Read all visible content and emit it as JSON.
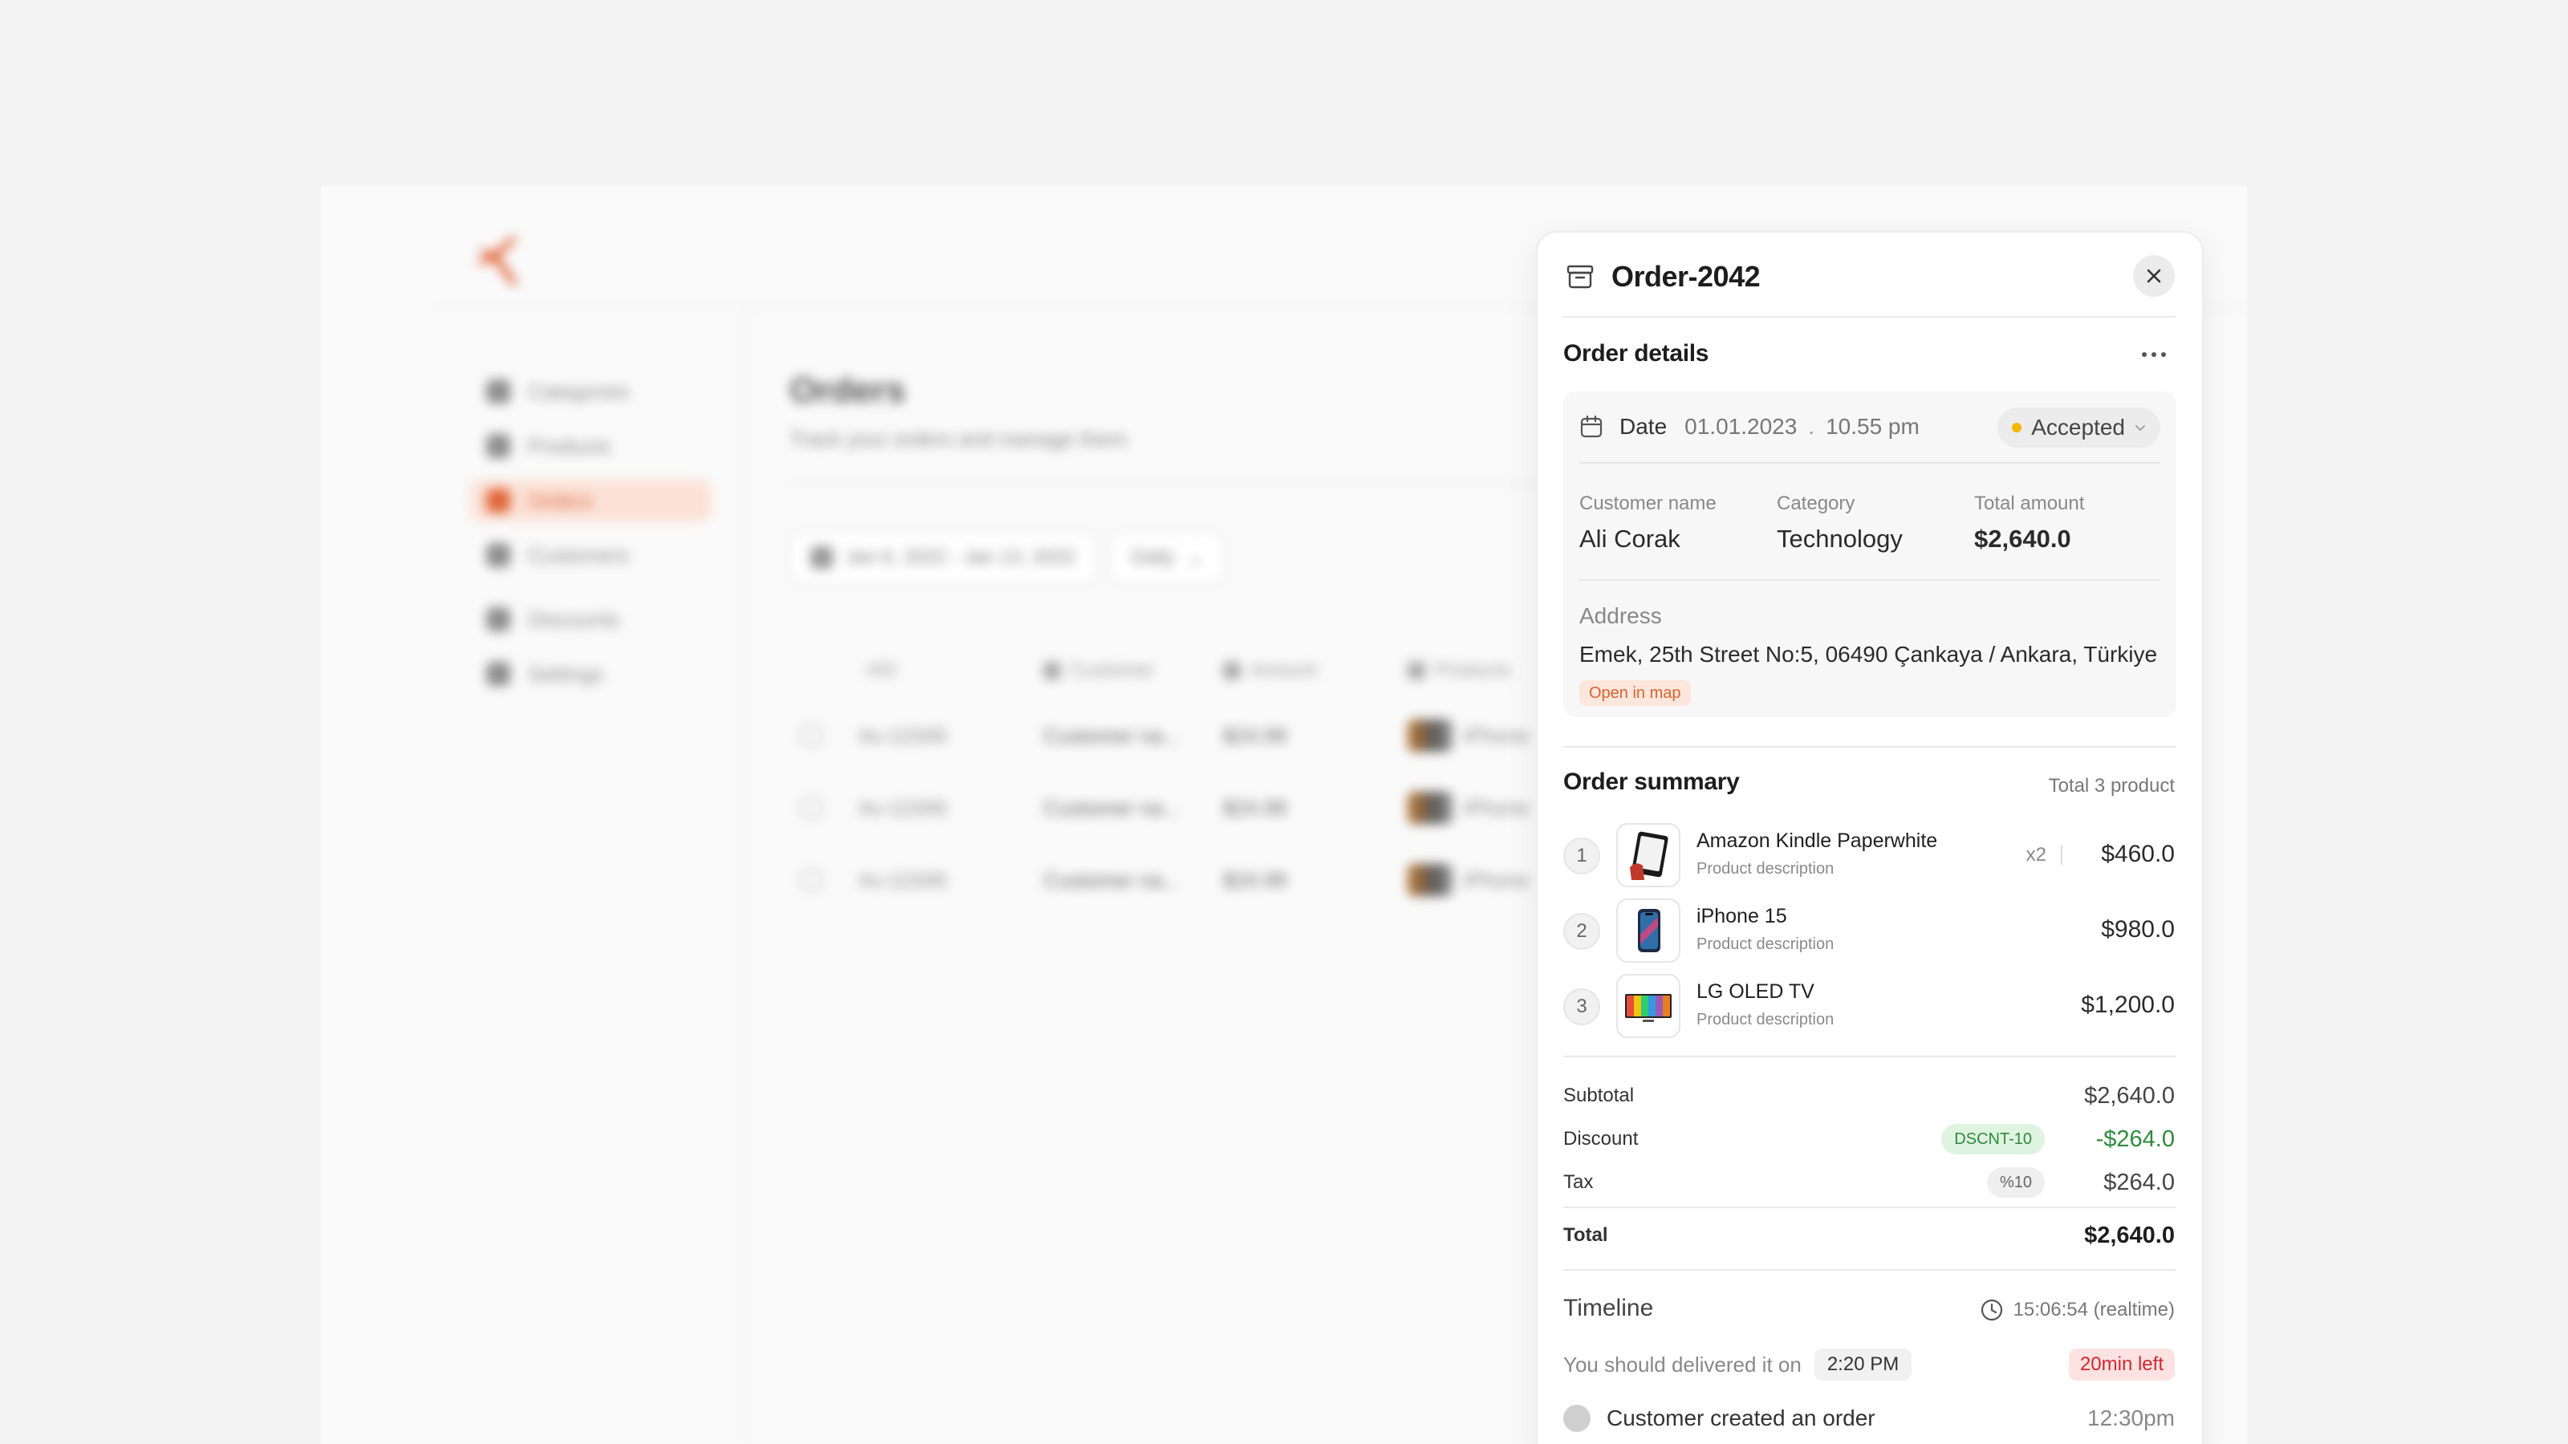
{
  "background": {
    "nav": [
      {
        "label": "Categories",
        "active": false
      },
      {
        "label": "Products",
        "active": false
      },
      {
        "label": "Orders",
        "active": true
      },
      {
        "label": "Customers",
        "active": false
      },
      {
        "label": "Discounts",
        "active": false
      },
      {
        "label": "Settings",
        "active": false
      }
    ],
    "page_title": "Orders",
    "page_subtitle": "Track your orders and manage them.",
    "date_filter": "Jan 6, 2022 - Jan 13, 2022",
    "period_filter": "Daily",
    "columns": [
      "#ID",
      "Customer",
      "Amount",
      "Products"
    ],
    "rows": [
      {
        "id": "#u-12345",
        "customer": "Customer na...",
        "amount": "$24.99",
        "product": "iPhone"
      },
      {
        "id": "#u-12345",
        "customer": "Customer na...",
        "amount": "$24.99",
        "product": "iPhone"
      },
      {
        "id": "#u-12345",
        "customer": "Customer na...",
        "amount": "$24.99",
        "product": "iPhone"
      }
    ]
  },
  "drawer": {
    "title": "Order-2042",
    "details_title": "Order details",
    "date_label": "Date",
    "date_value": "01.01.2023",
    "date_separator": ".",
    "time_value": "10.55 pm",
    "status": "Accepted",
    "status_color": "#f2b705",
    "customer_label": "Customer name",
    "customer_value": "Ali Corak",
    "category_label": "Category",
    "category_value": "Technology",
    "total_label": "Total amount",
    "total_value": "$2,640.0",
    "address_label": "Address",
    "address_value": "Emek, 25th Street No:5, 06490 Çankaya / Ankara, Türkiye",
    "map_link": "Open in map",
    "summary_title": "Order summary",
    "summary_count": "Total 3 product",
    "products": [
      {
        "num": "1",
        "name": "Amazon Kindle Paperwhite",
        "desc": "Product description",
        "qty": "x2",
        "price": "$460.0",
        "icon": "kindle-icon"
      },
      {
        "num": "2",
        "name": "iPhone 15",
        "desc": "Product description",
        "qty": "",
        "price": "$980.0",
        "icon": "iphone-icon"
      },
      {
        "num": "3",
        "name": "LG OLED TV",
        "desc": "Product description",
        "qty": "",
        "price": "$1,200.0",
        "icon": "tv-icon"
      }
    ],
    "subtotal_label": "Subtotal",
    "subtotal_value": "$2,640.0",
    "discount_label": "Discount",
    "discount_code": "DSCNT-10",
    "discount_value": "-$264.0",
    "tax_label": "Tax",
    "tax_rate": "%10",
    "tax_value": "$264.0",
    "grand_total_label": "Total",
    "grand_total_value": "$2,640.0",
    "timeline_title": "Timeline",
    "realtime": "15:06:54 (realtime)",
    "deliver_text": "You should delivered it on",
    "deliver_time": "2:20 PM",
    "time_left": "20min left",
    "event_text": "Customer created an order",
    "event_time": "12:30pm"
  },
  "colors": {
    "accent": "#e0663b",
    "discount_green": "#2e8b3c",
    "alert_red": "#d3272f"
  }
}
